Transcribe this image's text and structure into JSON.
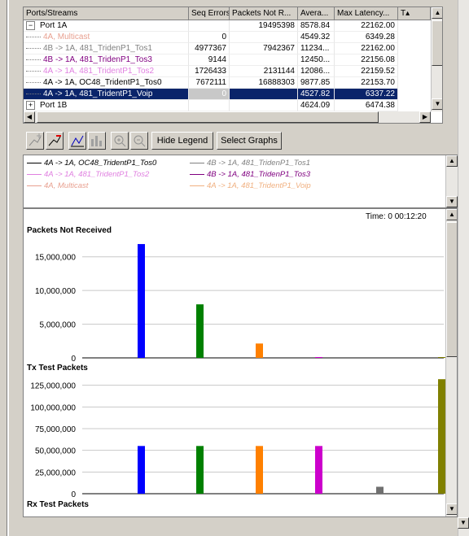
{
  "grid": {
    "columns": [
      "Ports/Streams",
      "Seq Errors",
      "Packets Not R...",
      "Avera...",
      "Max Latency...",
      "T▴"
    ],
    "rows": [
      {
        "name": "Port 1A",
        "seq": "",
        "pnr": "19495398",
        "avg": "8578.84",
        "max": "22162.00",
        "color": "#000000",
        "expander": "−"
      },
      {
        "name": "4A, Multicast",
        "seq": "0",
        "pnr": "",
        "avg": "4549.32",
        "max": "6349.28",
        "color": "#e8a090",
        "expander": ""
      },
      {
        "name": "4B -> 1A, 481_TridenP1_Tos1",
        "seq": "4977367",
        "pnr": "7942367",
        "avg": "11234...",
        "max": "22162.00",
        "color": "#808080",
        "expander": ""
      },
      {
        "name": "4B -> 1A, 481_TridenP1_Tos3",
        "seq": "9144",
        "pnr": "",
        "avg": "12450...",
        "max": "22156.08",
        "color": "#800080",
        "expander": ""
      },
      {
        "name": "4A -> 1A, 481_TridentP1_Tos2",
        "seq": "1726433",
        "pnr": "2131144",
        "avg": "12086...",
        "max": "22159.52",
        "color": "#e080e0",
        "expander": ""
      },
      {
        "name": "4A -> 1A, OC48_TridentP1_Tos0",
        "seq": "7672111",
        "pnr": "16888303",
        "avg": "9877.85",
        "max": "22153.70",
        "color": "#000000",
        "expander": ""
      },
      {
        "name": "4A -> 1A, 481_TridentP1_Voip",
        "seq": "0",
        "pnr": "",
        "avg": "4527.82",
        "max": "6337.22",
        "color": "#ffffff",
        "expander": "",
        "selected": true
      },
      {
        "name": "Port 1B",
        "seq": "",
        "pnr": "",
        "avg": "4624.09",
        "max": "6474.38",
        "color": "#000000",
        "expander": "+"
      }
    ]
  },
  "toolbar": {
    "hide_legend": "Hide Legend",
    "select_graphs": "Select Graphs"
  },
  "legend": {
    "items": [
      {
        "label": "4A -> 1A, OC48_TridentP1_Tos0",
        "color": "#000000"
      },
      {
        "label": "4B -> 1A, 481_TridenP1_Tos1",
        "color": "#808080"
      },
      {
        "label": "4A -> 1A, 481_TridentP1_Tos2",
        "color": "#e080e0"
      },
      {
        "label": "4B -> 1A, 481_TridenP1_Tos3",
        "color": "#800080"
      },
      {
        "label": "4A, Multicast",
        "color": "#e8a090"
      },
      {
        "label": "4A -> 1A, 481_TridentP1_Voip",
        "color": "#f0b080"
      }
    ]
  },
  "time_label": "Time: 0 00:12:20",
  "chart_data": [
    {
      "type": "bar",
      "title": "Packets Not Received",
      "ylim": [
        0,
        17500000
      ],
      "yticks": [
        0,
        5000000,
        10000000,
        15000000
      ],
      "ytick_labels": [
        "0",
        "5,000,000",
        "10,000,000",
        "15,000,000"
      ],
      "values": [
        16888303,
        7942367,
        2131144,
        50000,
        0,
        0
      ],
      "colors": [
        "#0000ff",
        "#008000",
        "#ff8000",
        "#cc00cc",
        "#808080",
        "#808000"
      ],
      "grid": true
    },
    {
      "type": "bar",
      "title": "Tx Test Packets",
      "ylim": [
        0,
        135000000
      ],
      "yticks": [
        0,
        25000000,
        50000000,
        75000000,
        100000000,
        125000000
      ],
      "ytick_labels": [
        "0",
        "25,000,000",
        "50,000,000",
        "75,000,000",
        "100,000,000",
        "125,000,000"
      ],
      "values": [
        55000000,
        55000000,
        55000000,
        55000000,
        8000000,
        132000000
      ],
      "colors": [
        "#0000ff",
        "#008000",
        "#ff8000",
        "#cc00cc",
        "#707070",
        "#808000"
      ],
      "grid": true
    },
    {
      "type": "bar",
      "title": "Rx Test Packets",
      "values": []
    }
  ]
}
